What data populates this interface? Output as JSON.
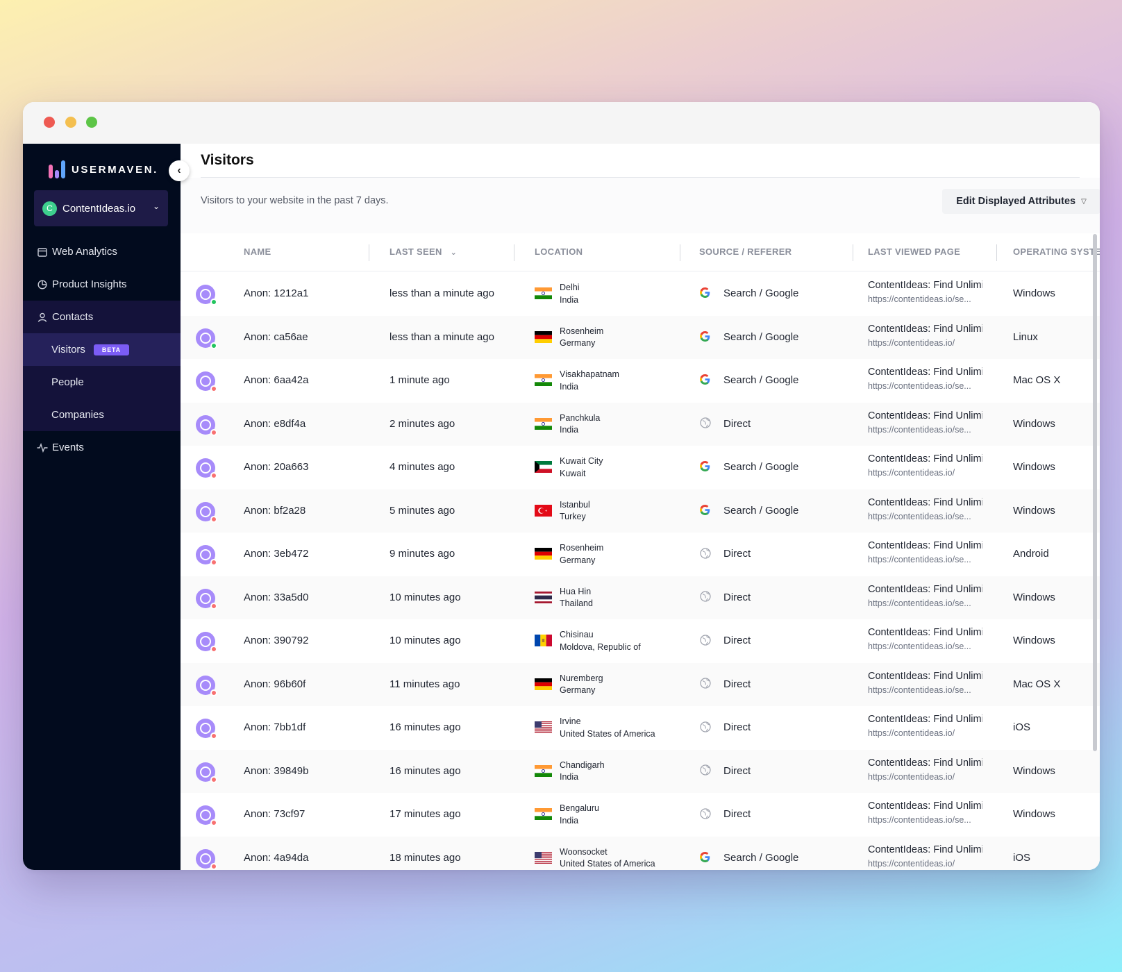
{
  "brand": {
    "name": "USERMAVEN.",
    "logo_colors": [
      "#f472b6",
      "#a78bfa",
      "#60a5fa"
    ]
  },
  "workspace": {
    "initial": "C",
    "name": "ContentIdeas.io"
  },
  "nav": {
    "web_analytics": "Web Analytics",
    "product_insights": "Product Insights",
    "contacts": "Contacts",
    "visitors": "Visitors",
    "beta": "BETA",
    "people": "People",
    "companies": "Companies",
    "events": "Events"
  },
  "page": {
    "title": "Visitors",
    "subtitle": "Visitors to your website in the past 7 days.",
    "edit_button": "Edit Displayed Attributes"
  },
  "columns": {
    "name": "NAME",
    "last_seen": "LAST SEEN",
    "location": "LOCATION",
    "source": "SOURCE / REFERER",
    "last_viewed_page": "LAST VIEWED PAGE",
    "os": "OPERATING SYSTEM"
  },
  "colors": {
    "accent": "#7b5cf5",
    "online": "#22c55e",
    "offline": "#f87171"
  },
  "rows": [
    {
      "name": "Anon: 1212a1",
      "seen": "less than a minute ago",
      "city": "Delhi",
      "country": "India",
      "flag": "in",
      "source": "Search / Google",
      "source_icon": "google",
      "page": "ContentIdeas: Find Unlimited",
      "url": "https://contentideas.io/se...",
      "os": "Windows",
      "status": "online"
    },
    {
      "name": "Anon: ca56ae",
      "seen": "less than a minute ago",
      "city": "Rosenheim",
      "country": "Germany",
      "flag": "de",
      "source": "Search / Google",
      "source_icon": "google",
      "page": "ContentIdeas: Find Unlimited",
      "url": "https://contentideas.io/",
      "os": "Linux",
      "status": "online"
    },
    {
      "name": "Anon: 6aa42a",
      "seen": "1 minute ago",
      "city": "Visakhapatnam",
      "country": "India",
      "flag": "in",
      "source": "Search / Google",
      "source_icon": "google",
      "page": "ContentIdeas: Find Unlimited",
      "url": "https://contentideas.io/se...",
      "os": "Mac OS X",
      "status": "offline"
    },
    {
      "name": "Anon: e8df4a",
      "seen": "2 minutes ago",
      "city": "Panchkula",
      "country": "India",
      "flag": "in",
      "source": "Direct",
      "source_icon": "globe",
      "page": "ContentIdeas: Find Unlimited",
      "url": "https://contentideas.io/se...",
      "os": "Windows",
      "status": "offline"
    },
    {
      "name": "Anon: 20a663",
      "seen": "4 minutes ago",
      "city": "Kuwait City",
      "country": "Kuwait",
      "flag": "kw",
      "source": "Search / Google",
      "source_icon": "google",
      "page": "ContentIdeas: Find Unlimited",
      "url": "https://contentideas.io/",
      "os": "Windows",
      "status": "offline"
    },
    {
      "name": "Anon: bf2a28",
      "seen": "5 minutes ago",
      "city": "Istanbul",
      "country": "Turkey",
      "flag": "tr",
      "source": "Search / Google",
      "source_icon": "google",
      "page": "ContentIdeas: Find Unlimited",
      "url": "https://contentideas.io/se...",
      "os": "Windows",
      "status": "offline"
    },
    {
      "name": "Anon: 3eb472",
      "seen": "9 minutes ago",
      "city": "Rosenheim",
      "country": "Germany",
      "flag": "de",
      "source": "Direct",
      "source_icon": "globe",
      "page": "ContentIdeas: Find Unlimited",
      "url": "https://contentideas.io/se...",
      "os": "Android",
      "status": "offline"
    },
    {
      "name": "Anon: 33a5d0",
      "seen": "10 minutes ago",
      "city": "Hua Hin",
      "country": "Thailand",
      "flag": "th",
      "source": "Direct",
      "source_icon": "globe",
      "page": "ContentIdeas: Find Unlimited",
      "url": "https://contentideas.io/se...",
      "os": "Windows",
      "status": "offline"
    },
    {
      "name": "Anon: 390792",
      "seen": "10 minutes ago",
      "city": "Chisinau",
      "country": "Moldova, Republic of",
      "flag": "md",
      "source": "Direct",
      "source_icon": "globe",
      "page": "ContentIdeas: Find Unlimited",
      "url": "https://contentideas.io/se...",
      "os": "Windows",
      "status": "offline"
    },
    {
      "name": "Anon: 96b60f",
      "seen": "11 minutes ago",
      "city": "Nuremberg",
      "country": "Germany",
      "flag": "de",
      "source": "Direct",
      "source_icon": "globe",
      "page": "ContentIdeas: Find Unlimited",
      "url": "https://contentideas.io/se...",
      "os": "Mac OS X",
      "status": "offline"
    },
    {
      "name": "Anon: 7bb1df",
      "seen": "16 minutes ago",
      "city": "Irvine",
      "country": "United States of America",
      "flag": "us",
      "source": "Direct",
      "source_icon": "globe",
      "page": "ContentIdeas: Find Unlimited",
      "url": "https://contentideas.io/",
      "os": "iOS",
      "status": "offline"
    },
    {
      "name": "Anon: 39849b",
      "seen": "16 minutes ago",
      "city": "Chandigarh",
      "country": "India",
      "flag": "in",
      "source": "Direct",
      "source_icon": "globe",
      "page": "ContentIdeas: Find Unlimited",
      "url": "https://contentideas.io/",
      "os": "Windows",
      "status": "offline"
    },
    {
      "name": "Anon: 73cf97",
      "seen": "17 minutes ago",
      "city": "Bengaluru",
      "country": "India",
      "flag": "in",
      "source": "Direct",
      "source_icon": "globe",
      "page": "ContentIdeas: Find Unlimited",
      "url": "https://contentideas.io/se...",
      "os": "Windows",
      "status": "offline"
    },
    {
      "name": "Anon: 4a94da",
      "seen": "18 minutes ago",
      "city": "Woonsocket",
      "country": "United States of America",
      "flag": "us",
      "source": "Search / Google",
      "source_icon": "google",
      "page": "ContentIdeas: Find Unlimited",
      "url": "https://contentideas.io/",
      "os": "iOS",
      "status": "offline"
    }
  ]
}
